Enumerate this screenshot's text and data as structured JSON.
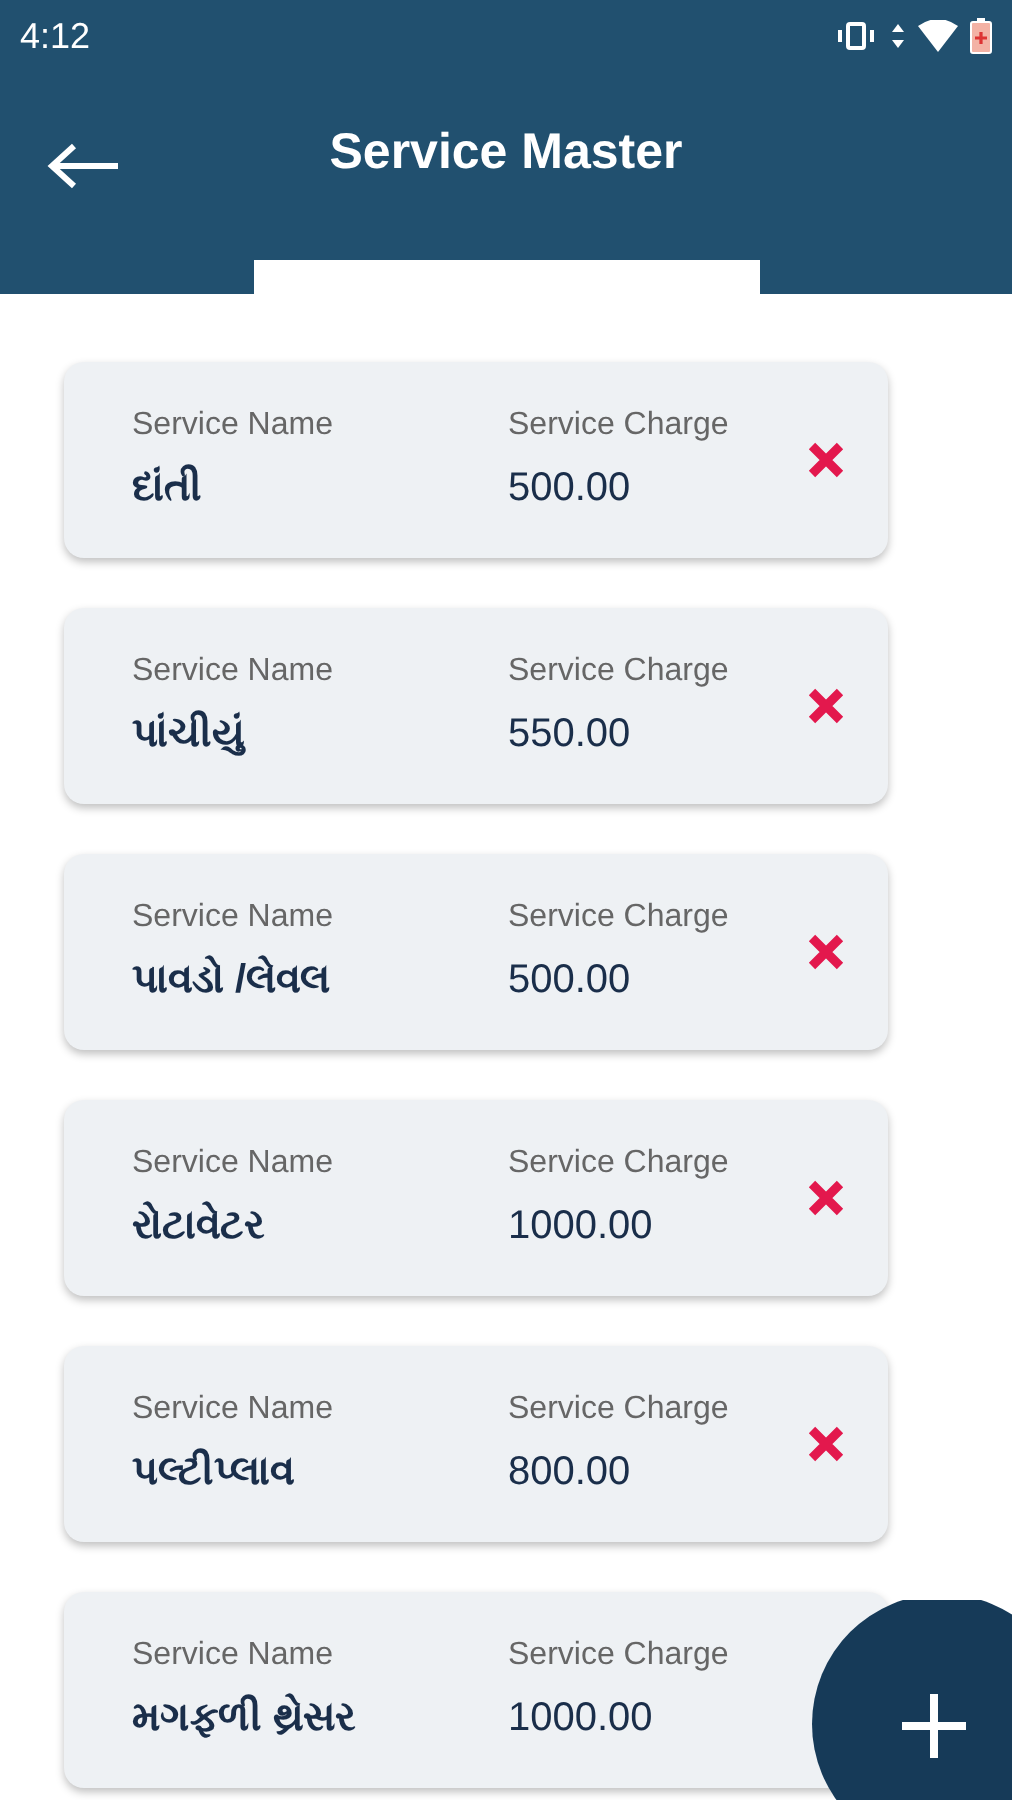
{
  "status_bar": {
    "time": "4:12"
  },
  "app_bar": {
    "title": "Service Master"
  },
  "services": [
    {
      "name_label": "Service Name",
      "name": "દાંતી",
      "charge_label": "Service Charge",
      "charge": "500.00",
      "delete_icon": true
    },
    {
      "name_label": "Service Name",
      "name": "પાંચીયું",
      "charge_label": "Service Charge",
      "charge": "550.00",
      "delete_icon": true
    },
    {
      "name_label": "Service Name",
      "name": "પાવડો /લેવલ",
      "charge_label": "Service Charge",
      "charge": "500.00",
      "delete_icon": true
    },
    {
      "name_label": "Service Name",
      "name": "રોટાવેટર",
      "charge_label": "Service Charge",
      "charge": "1000.00",
      "delete_icon": true
    },
    {
      "name_label": "Service Name",
      "name": "પલ્ટીપ્લાવ",
      "charge_label": "Service Charge",
      "charge": "800.00",
      "delete_icon": true
    },
    {
      "name_label": "Service Name",
      "name": "મગફળી થ્રેસર",
      "charge_label": "Service Charge",
      "charge": "1000.00",
      "delete_icon": false
    }
  ]
}
